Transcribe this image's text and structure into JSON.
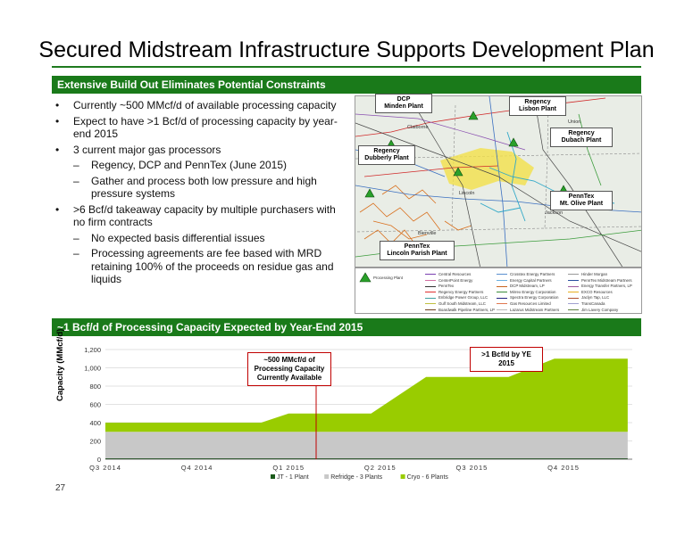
{
  "title": "Secured Midstream Infrastructure Supports Development Plan",
  "section1": {
    "heading": "Extensive Build Out Eliminates Potential Constraints",
    "bullets": [
      {
        "text": "Currently ~500 MMcf/d of available processing capacity",
        "subs": []
      },
      {
        "text": "Expect to have >1 Bcf/d of processing capacity by year-end 2015",
        "subs": []
      },
      {
        "text": "3 current major gas processors",
        "subs": [
          "Regency, DCP and PennTex (June 2015)",
          "Gather and process both low pressure and high pressure systems"
        ]
      },
      {
        "text": ">6 Bcf/d takeaway capacity by multiple purchasers with no firm contracts",
        "subs": [
          "No expected basis differential issues",
          "Processing agreements are fee based with MRD retaining 100% of the proceeds on residue gas and liquids"
        ]
      }
    ]
  },
  "map": {
    "plants": [
      {
        "label": "DCP\nMinden Plant"
      },
      {
        "label": "Regency\nLisbon Plant"
      },
      {
        "label": "Regency\nDubach Plant"
      },
      {
        "label": "Regency\nDubberly Plant"
      },
      {
        "label": "PennTex\nMt. Olive Plant"
      },
      {
        "label": "PennTex\nLincoln Parish Plant"
      }
    ],
    "places": [
      "Claiborne",
      "Union",
      "Lincoln",
      "Jackson",
      "Bienville"
    ],
    "legend": {
      "processing_plant": "Processing Plant",
      "items": [
        {
          "label": "Central Resources",
          "color": "#7a3fb0"
        },
        {
          "label": "Crosstex Energy Partners",
          "color": "#5a8fd0"
        },
        {
          "label": "Hinder Morgan",
          "color": "#999999"
        },
        {
          "label": "CenterPoint Energy",
          "color": "#d26ea0"
        },
        {
          "label": "Energy Capital Partners",
          "color": "#6ab0e0"
        },
        {
          "label": "PennTex Midstream Partners",
          "color": "#2a4fa0"
        },
        {
          "label": "PennTex",
          "color": "#333333"
        },
        {
          "label": "DCP Midstream, LP",
          "color": "#c86420"
        },
        {
          "label": "Energy Transfer Partners, LP",
          "color": "#9c5aa0"
        },
        {
          "label": "Regency Energy Partners",
          "color": "#e03030"
        },
        {
          "label": "Mirrex Energy Corporation",
          "color": "#3c8c3c"
        },
        {
          "label": "EXCO Resources",
          "color": "#e8b020"
        },
        {
          "label": "Enbridge Power Group, LLC",
          "color": "#40a0a0"
        },
        {
          "label": "Spectra Energy Corporation",
          "color": "#202080"
        },
        {
          "label": "Jaclyn Tap, LLC",
          "color": "#b05030"
        },
        {
          "label": "Gulf South Midstream, LLC",
          "color": "#c0c040"
        },
        {
          "label": "Gas Resources Limited",
          "color": "#e07850"
        },
        {
          "label": "TransCanada",
          "color": "#a0a0d0"
        },
        {
          "label": "Boardwalk Pipeline Partners, LP",
          "color": "#704020"
        },
        {
          "label": "Lazarus Midstream Partners",
          "color": "#bbbbbb"
        },
        {
          "label": "Jim Lavery Company",
          "color": "#608040"
        }
      ]
    }
  },
  "section2": {
    "heading": "~1 Bcf/d of Processing Capacity Expected by Year-End 2015",
    "annot1": "~500 MMcf/d of\nProcessing Capacity\nCurrently Available",
    "annot2": ">1 Bcf/d by YE 2015"
  },
  "chart_data": {
    "type": "area",
    "stacked": true,
    "title": "",
    "xlabel": "",
    "ylabel": "Capacity (MMcf/d)",
    "ylim": [
      0,
      1200
    ],
    "yticks": [
      0,
      200,
      400,
      600,
      800,
      1000,
      1200
    ],
    "ytick_labels": [
      "0",
      "200",
      "400",
      "600",
      "800",
      "1,000",
      "1,200"
    ],
    "xtick_labels": [
      "Q3 2014",
      "Q4 2014",
      "Q1 2015",
      "Q2 2015",
      "Q3 2015",
      "Q4 2015"
    ],
    "x": [
      0.0,
      1.7,
      2.0,
      2.9,
      3.5,
      4.4,
      4.9,
      5.7
    ],
    "series": [
      {
        "name": "JT - 1 Plant",
        "color": "#1a5a1a",
        "values": [
          10,
          10,
          10,
          10,
          10,
          10,
          10,
          10
        ]
      },
      {
        "name": "Refridge - 3 Plants",
        "color": "#c8c8c8",
        "values": [
          290,
          290,
          290,
          290,
          290,
          290,
          290,
          290
        ]
      },
      {
        "name": "Cryo - 6 Plants",
        "color": "#99cc00",
        "values": [
          100,
          100,
          200,
          200,
          600,
          600,
          800,
          800
        ]
      }
    ],
    "legend_position": "bottom",
    "grid": true
  },
  "page_number": "27"
}
